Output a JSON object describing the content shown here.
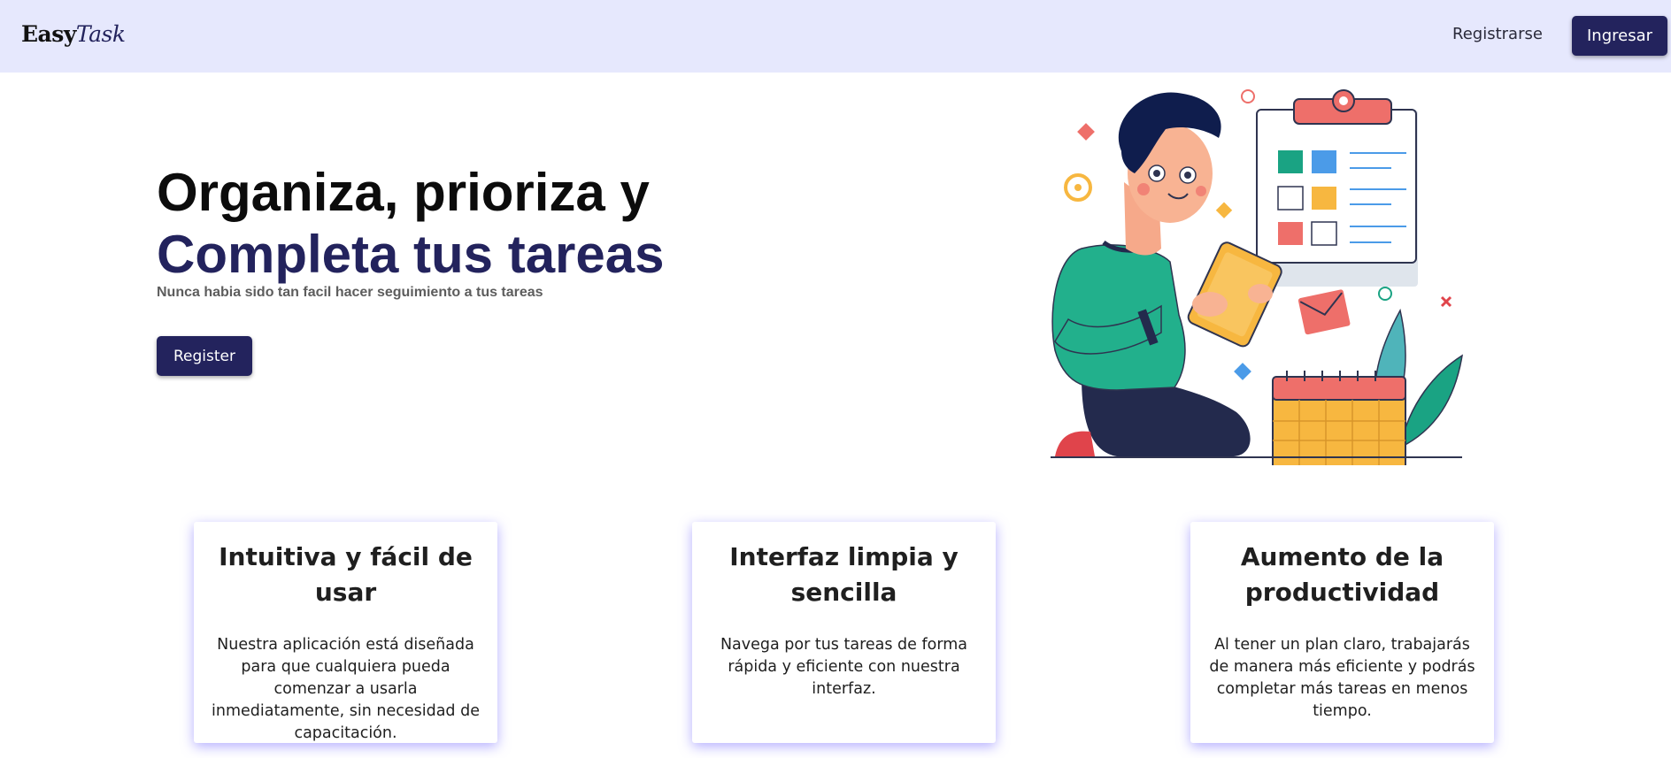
{
  "navbar": {
    "brand_part1": "Easy",
    "brand_part2": "Task",
    "register_link": "Registrarse",
    "login_button": "Ingresar"
  },
  "hero": {
    "title_line1": "Organiza, prioriza y",
    "title_line2": "Completa tus tareas",
    "subtitle": "Nunca habia sido tan facil hacer seguimiento a tus tareas",
    "cta_button": "Register"
  },
  "features": [
    {
      "title": "Intuitiva y fácil de usar",
      "text": "Nuestra aplicación está diseñada para que cualquiera pueda comenzar a usarla inmediatamente, sin necesidad de capacitación."
    },
    {
      "title": "Interfaz limpia y sencilla",
      "text": "Navega por tus tareas de forma rápida y eficiente con nuestra interfaz."
    },
    {
      "title": "Aumento de la productividad",
      "text": "Al tener un plan claro, trabajarás de manera más eficiente y podrás completar más tareas en menos tiempo."
    }
  ],
  "colors": {
    "navbar_bg": "#e6e8fd",
    "primary": "#23235d",
    "card_shadow": "#786eff",
    "subtitle": "#5d5d5d"
  },
  "icons": {
    "illustration": "person-with-tablet-checklist-illustration"
  }
}
